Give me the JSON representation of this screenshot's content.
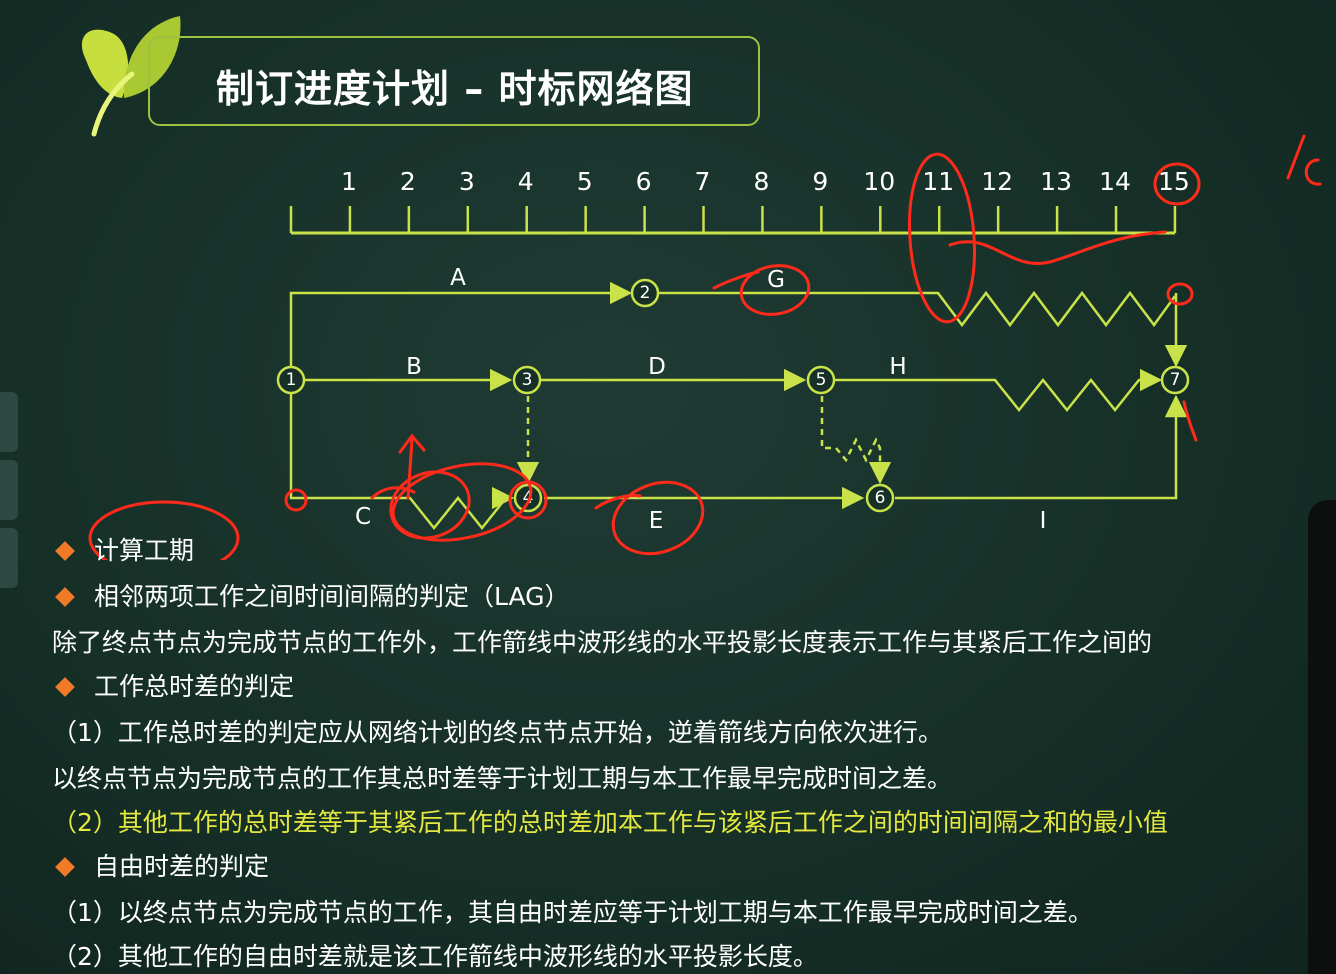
{
  "title": "制订进度计划 – 时标网络图",
  "colors": {
    "arrow": "#c9e24a",
    "ink": "#ff2a1a",
    "text": "#ffffff",
    "highlight": "#e4e840",
    "bullet": "#f07a28"
  },
  "timescale": [
    "1",
    "2",
    "3",
    "4",
    "5",
    "6",
    "7",
    "8",
    "9",
    "10",
    "11",
    "12",
    "13",
    "14",
    "15"
  ],
  "nodes": [
    "1",
    "2",
    "3",
    "4",
    "5",
    "6",
    "7"
  ],
  "activities": {
    "A": "A",
    "B": "B",
    "C": "C",
    "D": "D",
    "E": "E",
    "G": "G",
    "H": "H",
    "I": "I"
  },
  "lines": [
    {
      "bullet": true,
      "text": "计算工期"
    },
    {
      "bullet": true,
      "text": "相邻两项工作之间时间间隔的判定（LAG）"
    },
    {
      "bullet": false,
      "text": "除了终点节点为完成节点的工作外，工作箭线中波形线的水平投影长度表示工作与其紧后工作之间的"
    },
    {
      "bullet": true,
      "text": "工作总时差的判定"
    },
    {
      "bullet": false,
      "text": "（1）工作总时差的判定应从网络计划的终点节点开始，逆着箭线方向依次进行。"
    },
    {
      "bullet": false,
      "text": "以终点节点为完成节点的工作其总时差等于计划工期与本工作最早完成时间之差。"
    },
    {
      "bullet": false,
      "text": "（2）其他工作的总时差等于其紧后工作的总时差加本工作与该紧后工作之间的时间间隔之和的最小值"
    },
    {
      "bullet": true,
      "text": "自由时差的判定"
    },
    {
      "bullet": false,
      "text": "（1）以终点节点为完成节点的工作，其自由时差应等于计划工期与本工作最早完成时间之差。"
    },
    {
      "bullet": false,
      "text": "（2）其他工作的自由时差就是该工作箭线中波形线的水平投影长度。"
    }
  ]
}
